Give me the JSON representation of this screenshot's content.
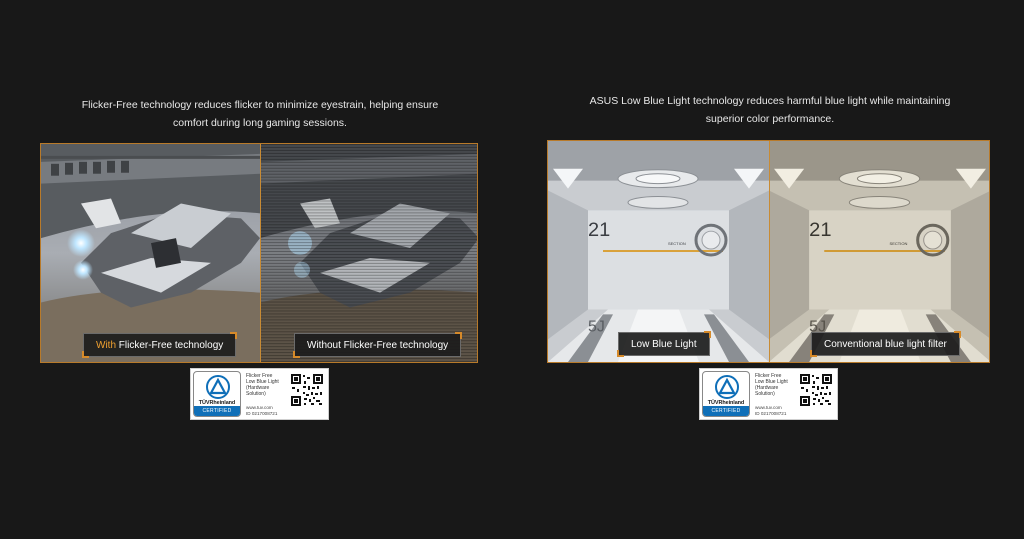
{
  "left_panel": {
    "caption_lines": [
      "Flicker-Free technology reduces flicker to minimize eyestrain, helping ensure",
      "comfort during long gaming sessions."
    ],
    "label_with_prefix": "With",
    "label_with_rest": " Flicker-Free technology",
    "label_without": "Without Flicker-Free technology"
  },
  "right_panel": {
    "caption_lines": [
      "ASUS Low Blue Light technology reduces harmful blue light while maintaining",
      "superior color performance."
    ],
    "label_low_blue": "Low Blue Light",
    "label_conventional": "Conventional blue light filter",
    "scene_number": "21",
    "scene_section": "SECTION",
    "scene_floor_code": "5J"
  },
  "badge_left": {
    "brand": "TÜVRheinland",
    "certified": "CERTIFIED",
    "lines": [
      "Flicker Free",
      "Low Blue Light",
      "(Hardware",
      "Solution)"
    ],
    "url": "www.tuv.com",
    "id": "ID 0217008721"
  },
  "badge_right": {
    "brand": "TÜVRheinland",
    "certified": "CERTIFIED",
    "lines": [
      "Flicker Free",
      "Low Blue Light",
      "(Hardware",
      "Solution)"
    ],
    "url": "www.tuv.com",
    "id": "ID 0217008721"
  },
  "colors": {
    "background": "#181818",
    "accent_orange": "#f0a030",
    "frame_border": "#b87a2a",
    "tuv_blue": "#0f6fb8"
  }
}
